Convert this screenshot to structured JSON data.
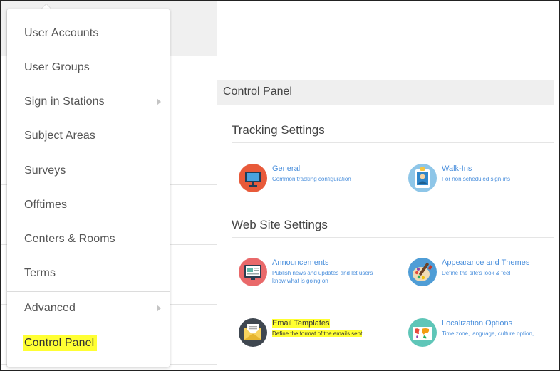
{
  "menu": {
    "items": [
      {
        "label": "User Accounts"
      },
      {
        "label": "User Groups"
      },
      {
        "label": "Sign in Stations"
      },
      {
        "label": "Subject Areas"
      },
      {
        "label": "Surveys"
      },
      {
        "label": "Offtimes"
      },
      {
        "label": "Centers & Rooms"
      },
      {
        "label": "Terms"
      },
      {
        "label": "Advanced"
      },
      {
        "label": "Control Panel"
      }
    ]
  },
  "panel": {
    "title": "Control Panel",
    "tracking_title": "Tracking Settings",
    "website_title": "Web Site Settings",
    "tiles": {
      "general": {
        "title": "General",
        "desc": "Common tracking configuration"
      },
      "walkins": {
        "title": "Walk-Ins",
        "desc": "For non scheduled sign-ins"
      },
      "announcements": {
        "title": "Announcements",
        "desc1": "Publish news and updates and let users",
        "desc2": "know what is going on"
      },
      "appearance": {
        "title": "Appearance and Themes",
        "desc": "Define the site's look & feel"
      },
      "email": {
        "title": "Email Templates",
        "desc": "Define the format of the emails sent"
      },
      "localization": {
        "title": "Localization Options",
        "desc": "Time zone, language, culture option, ..."
      }
    }
  },
  "colors": {
    "highlight": "#ffff33",
    "link": "#4a8fdc"
  }
}
